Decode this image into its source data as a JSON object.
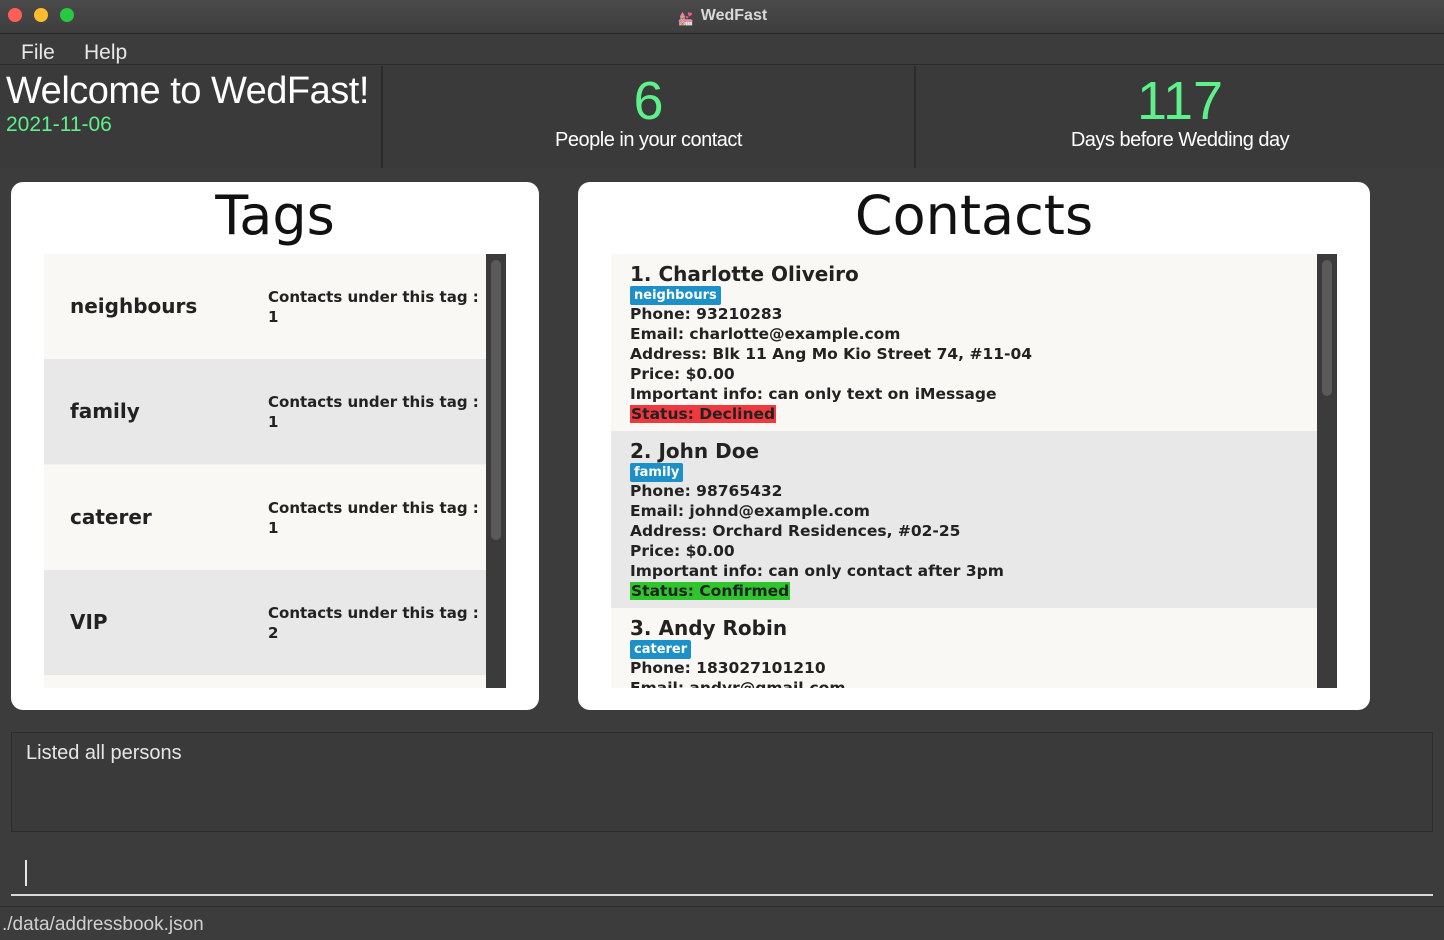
{
  "window": {
    "title": "WedFast"
  },
  "menu": {
    "file": "File",
    "help": "Help"
  },
  "header": {
    "welcome": "Welcome to WedFast!",
    "date": "2021-11-06",
    "contacts_count": "6",
    "contacts_label": "People in your contact",
    "days_count": "117",
    "days_label": "Days before Wedding day"
  },
  "tags_panel": {
    "title": "Tags",
    "count_label": "Contacts under this tag :",
    "items": [
      {
        "name": "neighbours",
        "count": "1"
      },
      {
        "name": "family",
        "count": "1"
      },
      {
        "name": "caterer",
        "count": "1"
      },
      {
        "name": "VIP",
        "count": "2"
      }
    ]
  },
  "contacts_panel": {
    "title": "Contacts",
    "items": [
      {
        "name": "1.  Charlotte Oliveiro",
        "tag": "neighbours",
        "phone": "Phone: 93210283",
        "email": "Email: charlotte@example.com",
        "address": "Address: Blk 11 Ang Mo Kio Street 74, #11-04",
        "price": "Price: $0.00",
        "info": "Important info: can only text on iMessage",
        "status": "Status: Declined"
      },
      {
        "name": "2.  John Doe",
        "tag": "family",
        "phone": "Phone: 98765432",
        "email": "Email: johnd@example.com",
        "address": "Address: Orchard Residences, #02-25",
        "price": "Price: $0.00",
        "info": "Important info: can only contact after 3pm",
        "status": "Status: Confirmed"
      },
      {
        "name": "3.  Andy Robin",
        "tag": "caterer",
        "phone": "Phone: 183027101210",
        "email": "Email: andyr@gmail.com"
      }
    ]
  },
  "result": {
    "text": "Listed all persons"
  },
  "command": {
    "value": ""
  },
  "statusbar": {
    "path": "./data/addressbook.json"
  },
  "colors": {
    "accent_green": "#5ef08a",
    "tag_blue": "#1e90c8",
    "declined": "#f0393e",
    "confirmed": "#2fc52c"
  }
}
